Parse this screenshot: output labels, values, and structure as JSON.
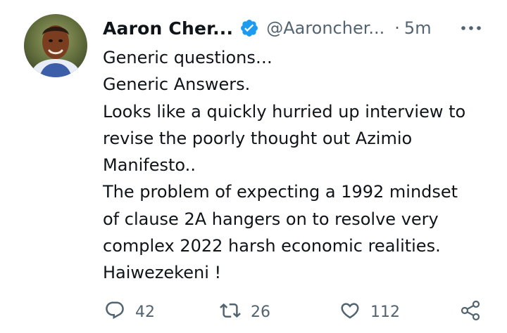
{
  "tweet": {
    "display_name": "Aaron Cher...",
    "handle": "@Aaroncher...",
    "separator": "·",
    "time": "5m",
    "lines": [
      "Generic questions…",
      "Generic Answers.",
      "Looks like a quickly hurried up interview to",
      "revise the poorly thought out Azimio",
      "Manifesto..",
      "The problem of expecting a 1992 mindset",
      "of clause 2A hangers on to resolve very",
      "complex 2022 harsh economic realities.",
      "Haiwezekeni !"
    ],
    "stats": {
      "replies": "42",
      "retweets": "26",
      "likes": "112"
    }
  },
  "colors": {
    "text": "#0f1419",
    "secondary": "#536471",
    "verified": "#1d9bf0"
  },
  "icons": {
    "verified": "verified-badge-icon",
    "more": "more-icon",
    "reply": "reply-icon",
    "retweet": "retweet-icon",
    "like": "like-icon",
    "share": "share-icon"
  }
}
